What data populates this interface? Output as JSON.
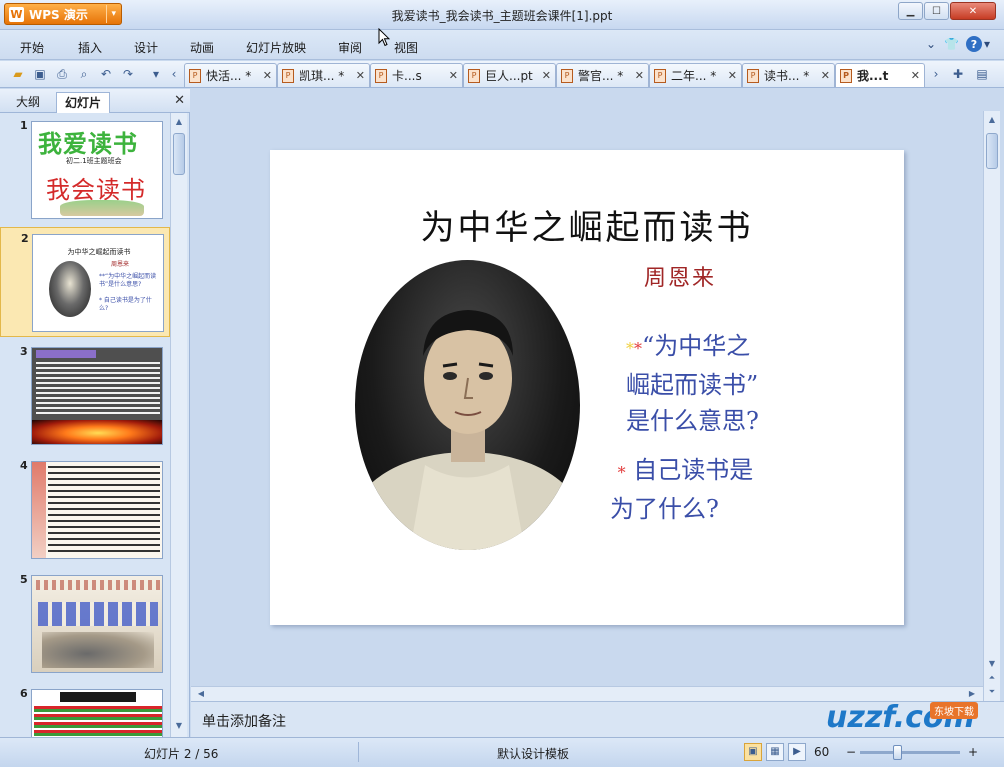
{
  "app": {
    "button_label": "WPS 演示",
    "window_title": "我爱读书_我会读书_主题班会课件[1].ppt"
  },
  "menu": [
    "开始",
    "插入",
    "设计",
    "动画",
    "幻灯片放映",
    "审阅",
    "视图"
  ],
  "doc_tabs": [
    {
      "label": "快活...",
      "modified": "*"
    },
    {
      "label": "凯琪...",
      "modified": "*"
    },
    {
      "label": "卡...s",
      "modified": ""
    },
    {
      "label": "巨人...pt",
      "modified": ""
    },
    {
      "label": "警官...",
      "modified": "*"
    },
    {
      "label": "二年...",
      "modified": "*"
    },
    {
      "label": "读书...",
      "modified": "*"
    },
    {
      "label": "我...t",
      "modified": ""
    }
  ],
  "left_panel": {
    "tabs": [
      "大纲",
      "幻灯片"
    ],
    "active_tab": "幻灯片",
    "thumbs": [
      {
        "num": "1",
        "title": "我爱读书",
        "sub": "初二.1班主题班会",
        "title2": "我会读书"
      },
      {
        "num": "2",
        "title": "为中华之崛起而读书",
        "sub": "周恩来",
        "q1": "**“为中华之崛起而读书”是什么意思?",
        "q2": "* 自己读书是为了什么?"
      },
      {
        "num": "3",
        "title": ""
      },
      {
        "num": "4",
        "title": ""
      },
      {
        "num": "5",
        "title": ""
      },
      {
        "num": "6",
        "title": ""
      }
    ]
  },
  "slide": {
    "title": "为中华之崛起而读书",
    "author": "周恩来",
    "question1_line1": "“为中华之",
    "question1_line2": "崛起而读书”",
    "question1_line3": "是什么意思?",
    "question2_line1": "自己读书是",
    "question2_line2": "为了什么?"
  },
  "notes_placeholder": "单击添加备注",
  "status": {
    "slide_counter": "幻灯片 2 / 56",
    "template": "默认设计模板",
    "zoom": "60"
  },
  "watermark": {
    "logo": "uzzf.com",
    "cn": "东坡下载"
  },
  "colors": {
    "accent_orange": "#e67308",
    "selected_thumb": "#fbe8b2",
    "question_blue": "#3a4ea8",
    "author_red": "#a02626"
  }
}
